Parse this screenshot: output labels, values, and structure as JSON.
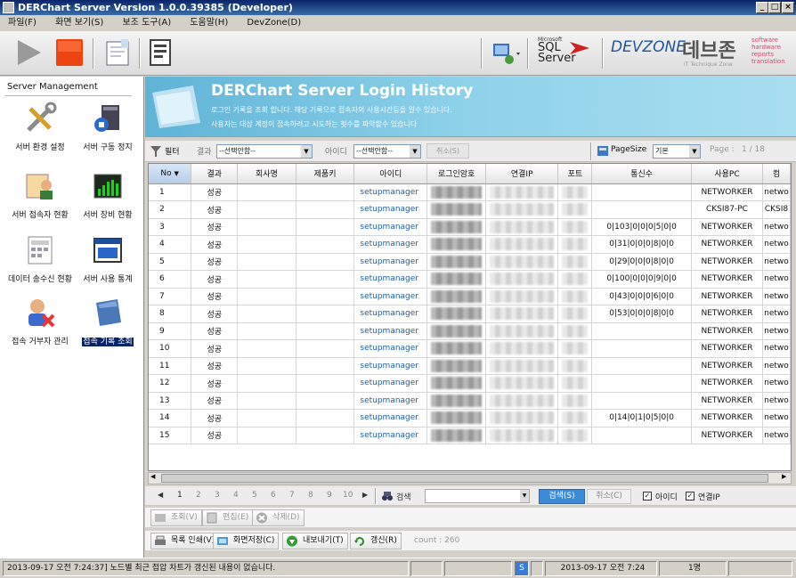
{
  "window": {
    "title": "DERChart Server Version 1.0.0.39385 (Developer)",
    "min": "_",
    "max": "□",
    "close": "×"
  },
  "menu": [
    "파일(F)",
    "화면 보기(S)",
    "보조 도구(A)",
    "도움말(H)",
    "DevZone(D)"
  ],
  "toolbar": {
    "sql_small": "Microsoft",
    "sql_big": "SQL",
    "sql_big2": "Server",
    "devzone": "DEVZONE",
    "brand_kr": "데브존",
    "tagline": "IT Technique Zone",
    "sw": [
      "software",
      "hardware",
      "reports",
      "translation"
    ]
  },
  "left": {
    "title": "Server Management",
    "items": [
      {
        "label": "서버 환경 설정"
      },
      {
        "label": "서버 구동 정지"
      },
      {
        "label": "서버 접속자 현황"
      },
      {
        "label": "서버 장비 현황"
      },
      {
        "label": "데이터 송수신 현황"
      },
      {
        "label": "서버 사용 통계"
      },
      {
        "label": "접속 거부자 관리"
      },
      {
        "label": "접속 기록 조회"
      }
    ]
  },
  "banner": {
    "title": "DERChart Server Login History",
    "desc1": "로그인 기록을 조회 합니다. 해당 기록으로 접속자의 사용시간등을 알수 있습니다.",
    "desc2": "사용자는 대상 계정이 접속하려고 시도하는 횟수를 파악할수 있습니다"
  },
  "filter": {
    "filter_label": "필터",
    "result_label": "결과",
    "result_value": "--선택안함--",
    "id_label": "아이디",
    "id_value": "--선택안함--",
    "cancel": "취소(S)",
    "pagesize_label": "PageSize",
    "pagesize_value": "기본",
    "page_label": "Page :",
    "page_value": "1 / 18"
  },
  "grid": {
    "columns": [
      "No",
      "결과",
      "회사명",
      "제품키",
      "아이디",
      "로그인암호",
      "연결IP",
      "포트",
      "통신수",
      "사용PC",
      "컴"
    ],
    "rows": [
      {
        "no": "1",
        "result": "성공",
        "id": "setupmanager",
        "comm": "",
        "pc": "NETWORKER",
        "pc2": "netwo"
      },
      {
        "no": "2",
        "result": "성공",
        "id": "setupmanager",
        "comm": "",
        "pc": "CKSI87-PC",
        "pc2": "CKSI8"
      },
      {
        "no": "3",
        "result": "성공",
        "id": "setupmanager",
        "comm": "0|103|0|0|0|5|0|0",
        "pc": "NETWORKER",
        "pc2": "netwo"
      },
      {
        "no": "4",
        "result": "성공",
        "id": "setupmanager",
        "comm": "0|31|0|0|0|8|0|0",
        "pc": "NETWORKER",
        "pc2": "netwo"
      },
      {
        "no": "5",
        "result": "성공",
        "id": "setupmanager",
        "comm": "0|29|0|0|0|8|0|0",
        "pc": "NETWORKER",
        "pc2": "netwo"
      },
      {
        "no": "6",
        "result": "성공",
        "id": "setupmanager",
        "comm": "0|100|0|0|0|9|0|0",
        "pc": "NETWORKER",
        "pc2": "netwo"
      },
      {
        "no": "7",
        "result": "성공",
        "id": "setupmanager",
        "comm": "0|43|0|0|0|6|0|0",
        "pc": "NETWORKER",
        "pc2": "netwo"
      },
      {
        "no": "8",
        "result": "성공",
        "id": "setupmanager",
        "comm": "0|53|0|0|0|8|0|0",
        "pc": "NETWORKER",
        "pc2": "netwo"
      },
      {
        "no": "9",
        "result": "성공",
        "id": "setupmanager",
        "comm": "",
        "pc": "NETWORKER",
        "pc2": "netwo"
      },
      {
        "no": "10",
        "result": "성공",
        "id": "setupmanager",
        "comm": "",
        "pc": "NETWORKER",
        "pc2": "netwo"
      },
      {
        "no": "11",
        "result": "성공",
        "id": "setupmanager",
        "comm": "",
        "pc": "NETWORKER",
        "pc2": "netwo"
      },
      {
        "no": "12",
        "result": "성공",
        "id": "setupmanager",
        "comm": "",
        "pc": "NETWORKER",
        "pc2": "netwo"
      },
      {
        "no": "13",
        "result": "성공",
        "id": "setupmanager",
        "comm": "",
        "pc": "NETWORKER",
        "pc2": "netwo"
      },
      {
        "no": "14",
        "result": "성공",
        "id": "setupmanager",
        "comm": "0|14|0|1|0|5|0|0",
        "pc": "NETWORKER",
        "pc2": "netwo"
      },
      {
        "no": "15",
        "result": "성공",
        "id": "setupmanager",
        "comm": "",
        "pc": "NETWORKER",
        "pc2": "netwo"
      }
    ]
  },
  "pager": {
    "pages": [
      "1",
      "2",
      "3",
      "4",
      "5",
      "6",
      "7",
      "8",
      "9",
      "10"
    ],
    "search_label": "검색",
    "search_btn": "검색(S)",
    "cancel_btn": "취소(C)",
    "chk_id": "아이디",
    "chk_ip": "연결IP"
  },
  "actions1": {
    "view": "조회(V)",
    "edit": "편집(E)",
    "del": "삭제(D)"
  },
  "actions2": {
    "print": "목록 인쇄(V)",
    "screen": "화면저장(C)",
    "export": "내보내기(T)",
    "refresh": "갱신(R)",
    "count": "count : 260"
  },
  "status": {
    "message": "2013-09-17 오전 7:24:37] 노드별 최근 접압 차트가 갱신된 내용이 없습니다.",
    "s": "S",
    "datetime": "2013-09-17 오전 7:24",
    "users": "1명"
  }
}
